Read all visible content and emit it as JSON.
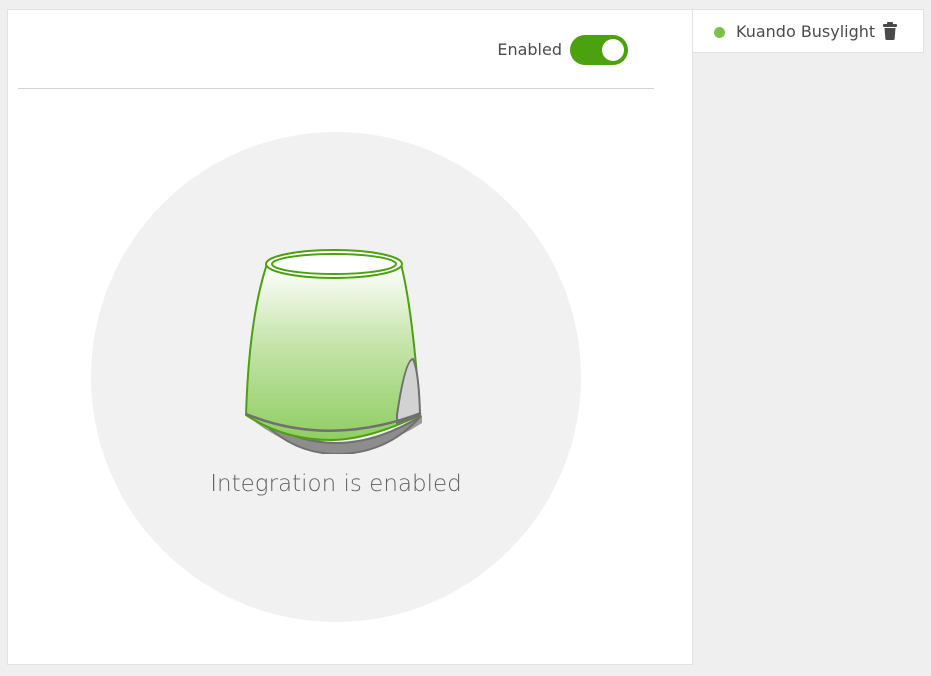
{
  "main": {
    "toggle": {
      "label": "Enabled",
      "state": "on",
      "color": "#4ca10f"
    },
    "status": {
      "text": "Integration is enabled",
      "icon": "busylight-device-icon",
      "circle_color": "#f1f1f1"
    }
  },
  "sidebar": {
    "items": [
      {
        "label": "Kuando Busylight",
        "status_color": "#7bc24d",
        "delete_icon": "trash-icon"
      }
    ]
  },
  "colors": {
    "accent": "#4ca10f",
    "status_dot": "#7bc24d",
    "device_green": "#64b52a",
    "device_base": "#8a8a8a"
  }
}
